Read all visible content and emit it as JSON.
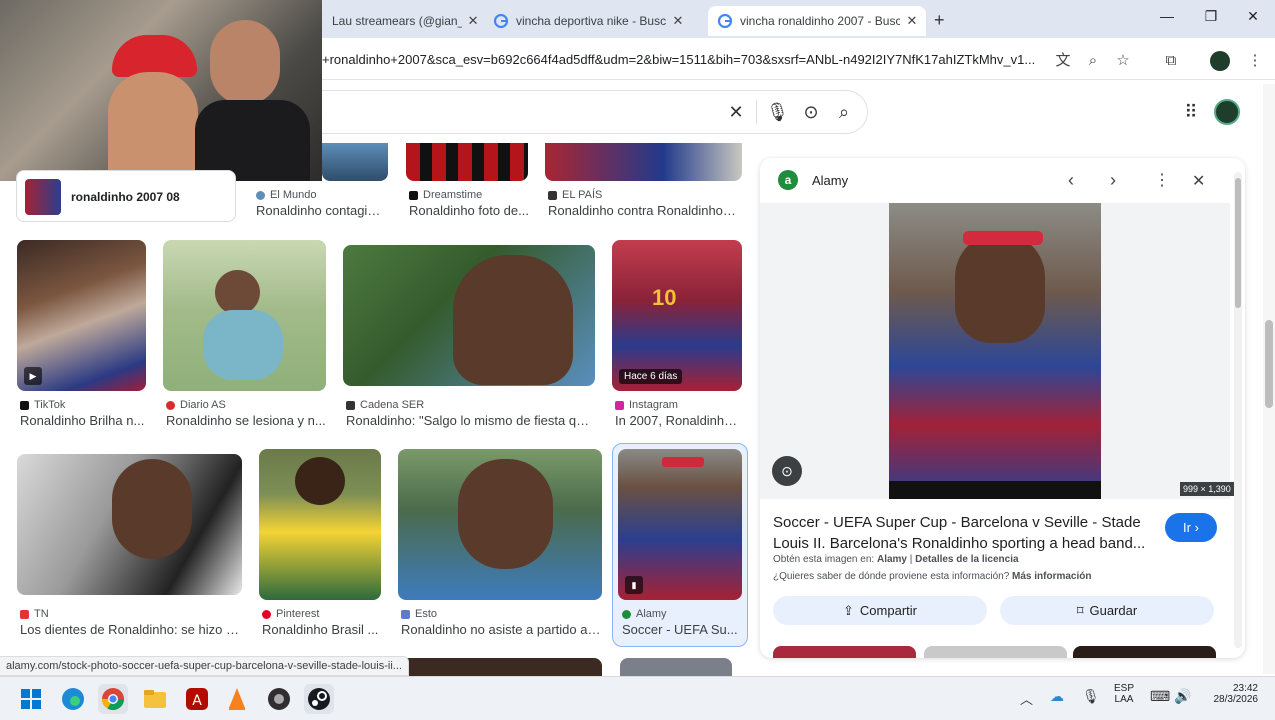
{
  "tabs": [
    {
      "title": "Lau streamears (@gian_l",
      "favicon": "avatar"
    },
    {
      "title": "vincha deportiva nike - Buscar c",
      "favicon": "google"
    },
    {
      "title": "vincha ronaldinho 2007 - Busca",
      "favicon": "google",
      "active": true
    }
  ],
  "new_tab_icon": "+",
  "url": "+ronaldinho+2007&sca_esv=b692c664f4ad5dff&udm=2&biw=1511&bih=703&sxsrf=ANbL-n492I2IY7NfK17ahIZTkMhv_v1...",
  "related_chip": {
    "label": "ronaldinho 2007 08"
  },
  "top_row": [
    {
      "source": "El Mundo",
      "caption": "Ronaldinho contagia ..."
    },
    {
      "source": "Dreamstime",
      "caption": "Ronaldinho foto de..."
    },
    {
      "source": "EL PAÍS",
      "caption": "Ronaldinho contra Ronaldinho | ..."
    }
  ],
  "row2": [
    {
      "source": "TikTok",
      "caption": "Ronaldinho Brilha n..."
    },
    {
      "source": "Diario AS",
      "caption": "Ronaldinho se lesiona y n..."
    },
    {
      "source": "Cadena SER",
      "caption": "Ronaldinho: \"Salgo lo mismo de fiesta que ..."
    },
    {
      "source": "Instagram",
      "caption": "In 2007, Ronaldinho...",
      "badge": "Hace 6 días"
    }
  ],
  "row3": [
    {
      "source": "TN",
      "caption": "Los dientes de Ronaldinho: se hizo un..."
    },
    {
      "source": "Pinterest",
      "caption": "Ronaldinho Brasil ..."
    },
    {
      "source": "Esto",
      "caption": "Ronaldinho no asiste a partido am..."
    },
    {
      "source": "Alamy",
      "caption": "Soccer - UEFA Su..."
    }
  ],
  "status_url": "alamy.com/stock-photo-soccer-uefa-super-cup-barcelona-v-seville-stade-louis-ii...",
  "panel": {
    "site": "Alamy",
    "dimensions": "999 × 1,390",
    "title": "Soccer - UEFA Super Cup - Barcelona v Seville - Stade Louis II. Barcelona's Ronaldinho sporting a head band...",
    "go_label": "Ir",
    "obtained_prefix": "Obtén esta imagen en:",
    "obtained_site": "Alamy",
    "license_link": "Detalles de la licencia",
    "source_question": "¿Quieres saber de dónde proviene esta información?",
    "more_info": "Más información",
    "share_label": "Compartir",
    "save_label": "Guardar"
  },
  "taskbar": {
    "lang": "ESP",
    "layout": "LAA",
    "time": "23:42",
    "date": "28/3/2026"
  },
  "colors": {
    "tabbar": "#dfe6f2",
    "accent": "#1a73e8",
    "pill": "#e8f0fe"
  }
}
